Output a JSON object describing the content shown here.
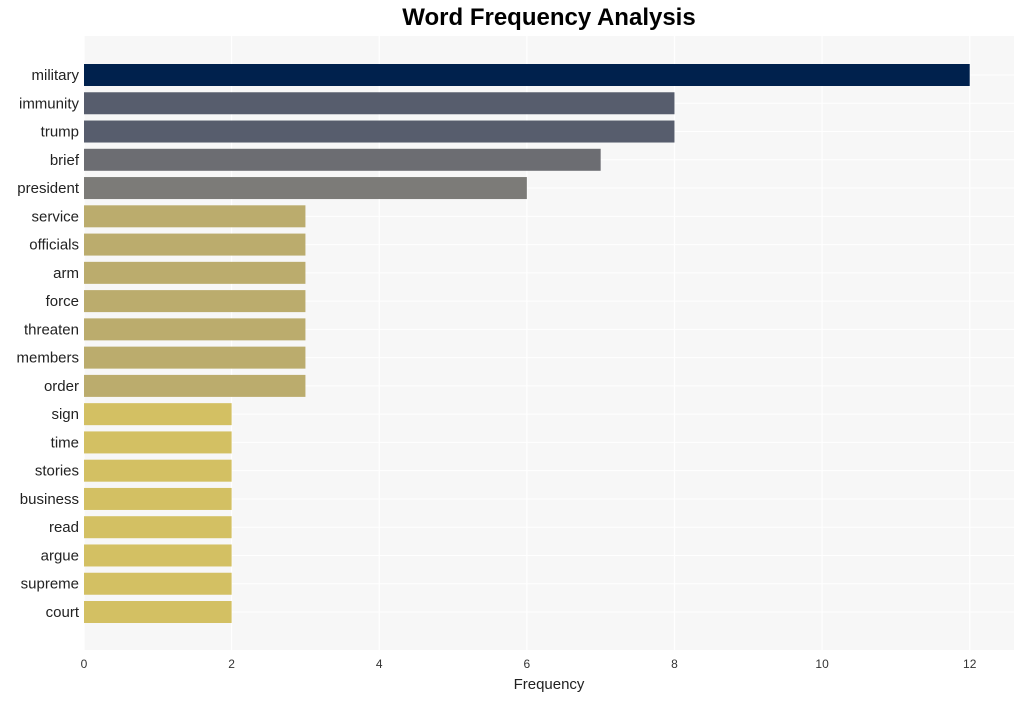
{
  "chart_data": {
    "type": "bar",
    "orientation": "horizontal",
    "title": "Word Frequency Analysis",
    "xlabel": "Frequency",
    "ylabel": "",
    "xlim": [
      0,
      12.6
    ],
    "xticks": [
      0,
      2,
      4,
      6,
      8,
      10,
      12
    ],
    "grid": true,
    "legend": "none",
    "categories": [
      "military",
      "immunity",
      "trump",
      "brief",
      "president",
      "service",
      "officials",
      "arm",
      "force",
      "threaten",
      "members",
      "order",
      "sign",
      "time",
      "stories",
      "business",
      "read",
      "argue",
      "supreme",
      "court"
    ],
    "values": [
      12,
      8,
      8,
      7,
      6,
      3,
      3,
      3,
      3,
      3,
      3,
      3,
      2,
      2,
      2,
      2,
      2,
      2,
      2,
      2
    ],
    "colors": [
      "#00214d",
      "#575d6d",
      "#575d6d",
      "#6c6d72",
      "#7c7b78",
      "#bbac6d",
      "#bbac6d",
      "#bbac6d",
      "#bbac6d",
      "#bbac6d",
      "#bbac6d",
      "#bbac6d",
      "#d3c063",
      "#d3c063",
      "#d3c063",
      "#d3c063",
      "#d3c063",
      "#d3c063",
      "#d3c063",
      "#d3c063"
    ],
    "plot_background": "#f7f7f7",
    "grid_color": "#ffffff"
  }
}
